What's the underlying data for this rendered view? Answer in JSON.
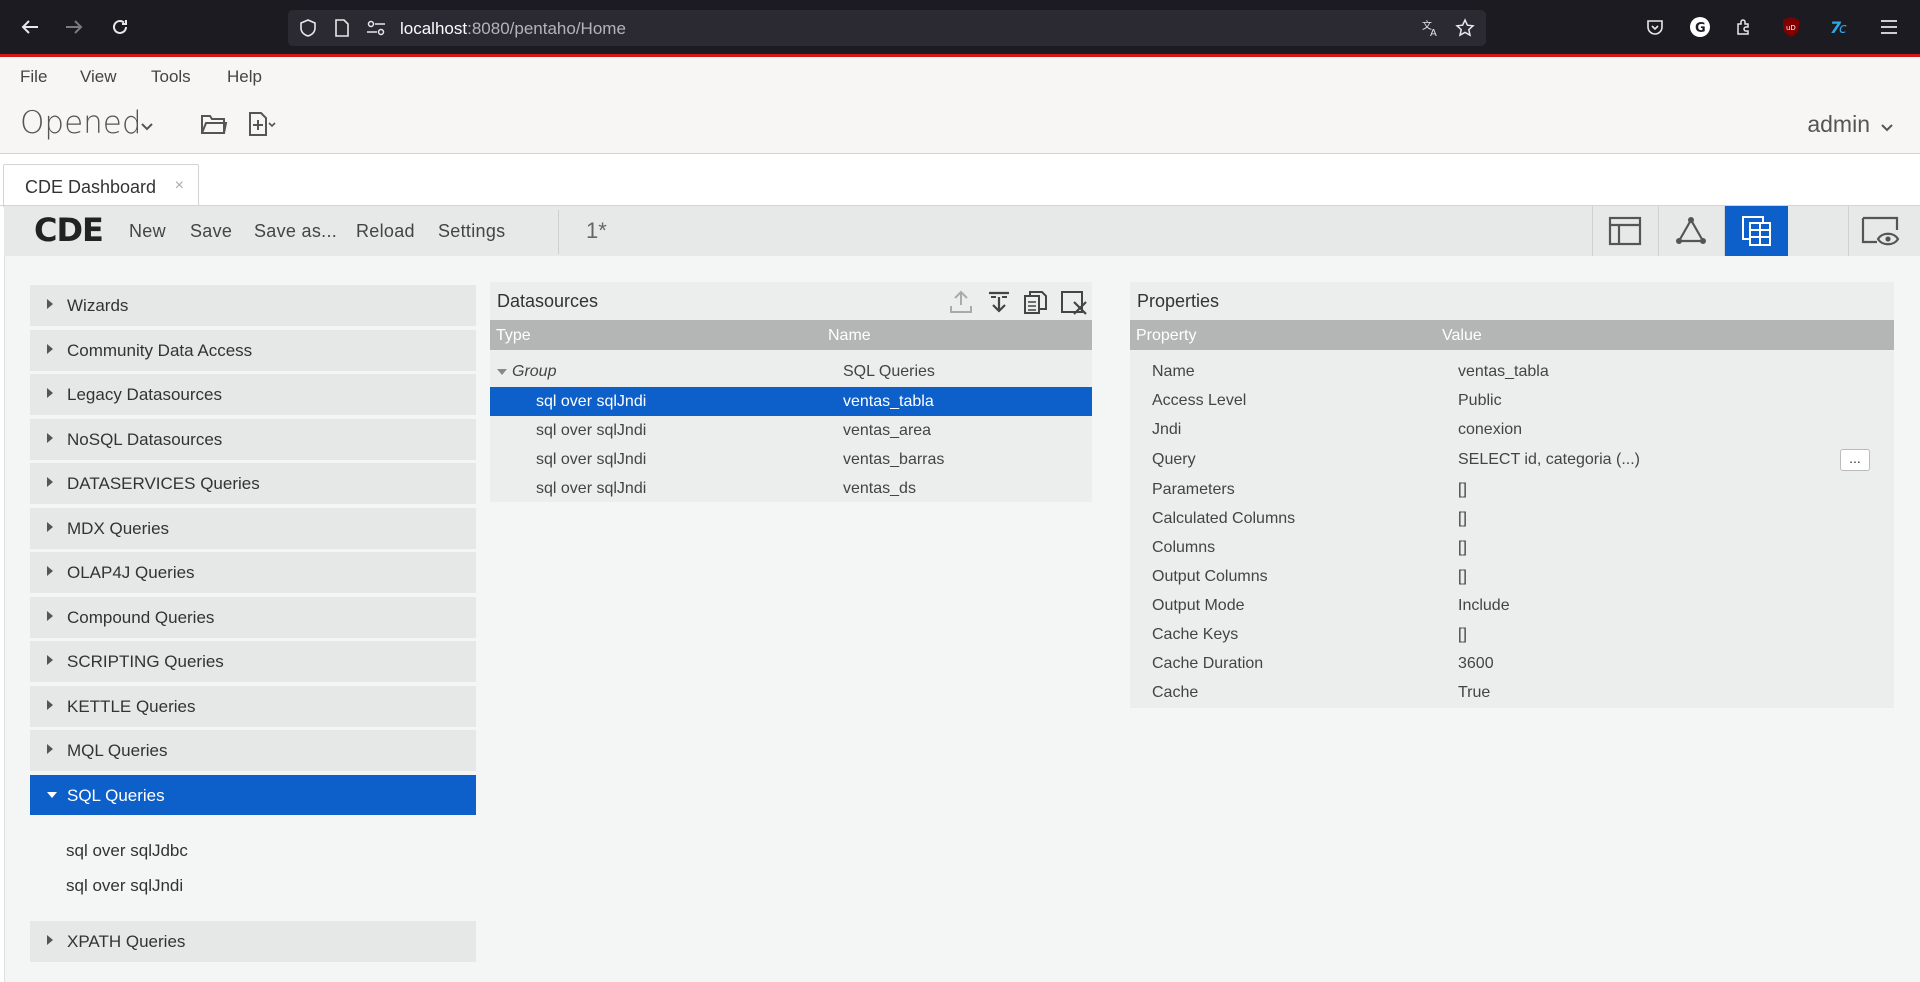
{
  "browser": {
    "url_host": "localhost",
    "url_rest": ":8080/pentaho/Home"
  },
  "menu": {
    "items": [
      "File",
      "View",
      "Tools",
      "Help"
    ]
  },
  "header": {
    "opened_label": "Opened",
    "user": "admin"
  },
  "tab": {
    "label": "CDE Dashboard",
    "close": "×"
  },
  "cde_toolbar": {
    "logo": "CDE",
    "buttons": [
      "New",
      "Save",
      "Save as...",
      "Reload",
      "Settings"
    ],
    "version": "1*"
  },
  "accordion": {
    "items": [
      "Wizards",
      "Community Data Access",
      "Legacy Datasources",
      "NoSQL Datasources",
      "DATASERVICES Queries",
      "MDX Queries",
      "OLAP4J Queries",
      "Compound Queries",
      "SCRIPTING Queries",
      "KETTLE Queries",
      "MQL Queries",
      "SQL Queries",
      "XPATH Queries"
    ],
    "open_item": "SQL Queries",
    "open_children": [
      "sql over sqlJdbc",
      "sql over sqlJndi"
    ]
  },
  "datasources": {
    "title": "Datasources",
    "columns": [
      "Type",
      "Name"
    ],
    "group": {
      "type": "Group",
      "name": "SQL Queries"
    },
    "rows": [
      {
        "type": "sql over sqlJndi",
        "name": "ventas_tabla",
        "selected": true
      },
      {
        "type": "sql over sqlJndi",
        "name": "ventas_area",
        "selected": false
      },
      {
        "type": "sql over sqlJndi",
        "name": "ventas_barras",
        "selected": false
      },
      {
        "type": "sql over sqlJndi",
        "name": "ventas_ds",
        "selected": false
      }
    ]
  },
  "properties": {
    "title": "Properties",
    "columns": [
      "Property",
      "Value"
    ],
    "rows": [
      {
        "property": "Name",
        "value": "ventas_tabla"
      },
      {
        "property": "Access Level",
        "value": "Public"
      },
      {
        "property": "Jndi",
        "value": "conexion"
      },
      {
        "property": "Query",
        "value": "SELECT id, categoria (...)"
      },
      {
        "property": "Parameters",
        "value": "[]"
      },
      {
        "property": "Calculated Columns",
        "value": "[]"
      },
      {
        "property": "Columns",
        "value": "[]"
      },
      {
        "property": "Output Columns",
        "value": "[]"
      },
      {
        "property": "Output Mode",
        "value": "Include"
      },
      {
        "property": "Cache Keys",
        "value": "[]"
      },
      {
        "property": "Cache Duration",
        "value": "3600"
      },
      {
        "property": "Cache",
        "value": "True"
      }
    ],
    "edit_button": "..."
  },
  "colors": {
    "accent": "#0d5fc9",
    "browser_red_line": "#d3151c"
  }
}
